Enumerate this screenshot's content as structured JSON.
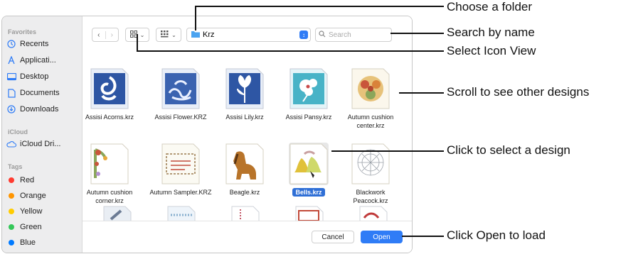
{
  "sidebar": {
    "favorites_heading": "Favorites",
    "favorites": [
      {
        "label": "Recents",
        "icon": "clock-icon"
      },
      {
        "label": "Applicati...",
        "icon": "applications-icon"
      },
      {
        "label": "Desktop",
        "icon": "desktop-icon"
      },
      {
        "label": "Documents",
        "icon": "document-icon"
      },
      {
        "label": "Downloads",
        "icon": "download-icon"
      }
    ],
    "icloud_heading": "iCloud",
    "icloud": [
      {
        "label": "iCloud Dri...",
        "icon": "cloud-icon"
      }
    ],
    "tags_heading": "Tags",
    "tags": [
      {
        "label": "Red",
        "color": "#ff3b30"
      },
      {
        "label": "Orange",
        "color": "#ff9500"
      },
      {
        "label": "Yellow",
        "color": "#ffcc00"
      },
      {
        "label": "Green",
        "color": "#34c759"
      },
      {
        "label": "Blue",
        "color": "#007aff"
      }
    ]
  },
  "toolbar": {
    "back_icon": "chevron-left-icon",
    "forward_icon": "chevron-right-icon",
    "view_icon": "icon-view-icon",
    "group_icon": "group-icon",
    "folder_name": "Krz",
    "search_placeholder": "Search"
  },
  "files": [
    {
      "name": "Assisi Acorns.krz",
      "icon": "assisi-acorns-thumbnail"
    },
    {
      "name": "Assisi Flower.KRZ",
      "icon": "assisi-flower-thumbnail"
    },
    {
      "name": "Assisi Lily.krz",
      "icon": "assisi-lily-thumbnail"
    },
    {
      "name": "Assisi Pansy.krz",
      "icon": "assisi-pansy-thumbnail"
    },
    {
      "name": "Autumn cushion center.krz",
      "icon": "autumn-cushion-center-thumbnail"
    },
    {
      "name": "Autumn cushion corner.krz",
      "icon": "autumn-cushion-corner-thumbnail"
    },
    {
      "name": "Autumn Sampler.KRZ",
      "icon": "autumn-sampler-thumbnail"
    },
    {
      "name": "Beagle.krz",
      "icon": "beagle-thumbnail"
    },
    {
      "name": "Bells.krz",
      "icon": "bells-thumbnail",
      "selected": true
    },
    {
      "name": "Blackwork Peacock.krz",
      "icon": "blackwork-peacock-thumbnail"
    }
  ],
  "footer": {
    "cancel_label": "Cancel",
    "open_label": "Open"
  },
  "callouts": {
    "choose_folder": "Choose a folder",
    "search_by_name": "Search by name",
    "select_icon_view": "Select Icon View",
    "scroll": "Scroll to see other designs",
    "click_select": "Click to select a design",
    "click_open": "Click Open to load"
  },
  "colors": {
    "accent": "#2f7cf6",
    "assisi_blue": "#2e56a4",
    "selection": "#2f6fd6"
  }
}
